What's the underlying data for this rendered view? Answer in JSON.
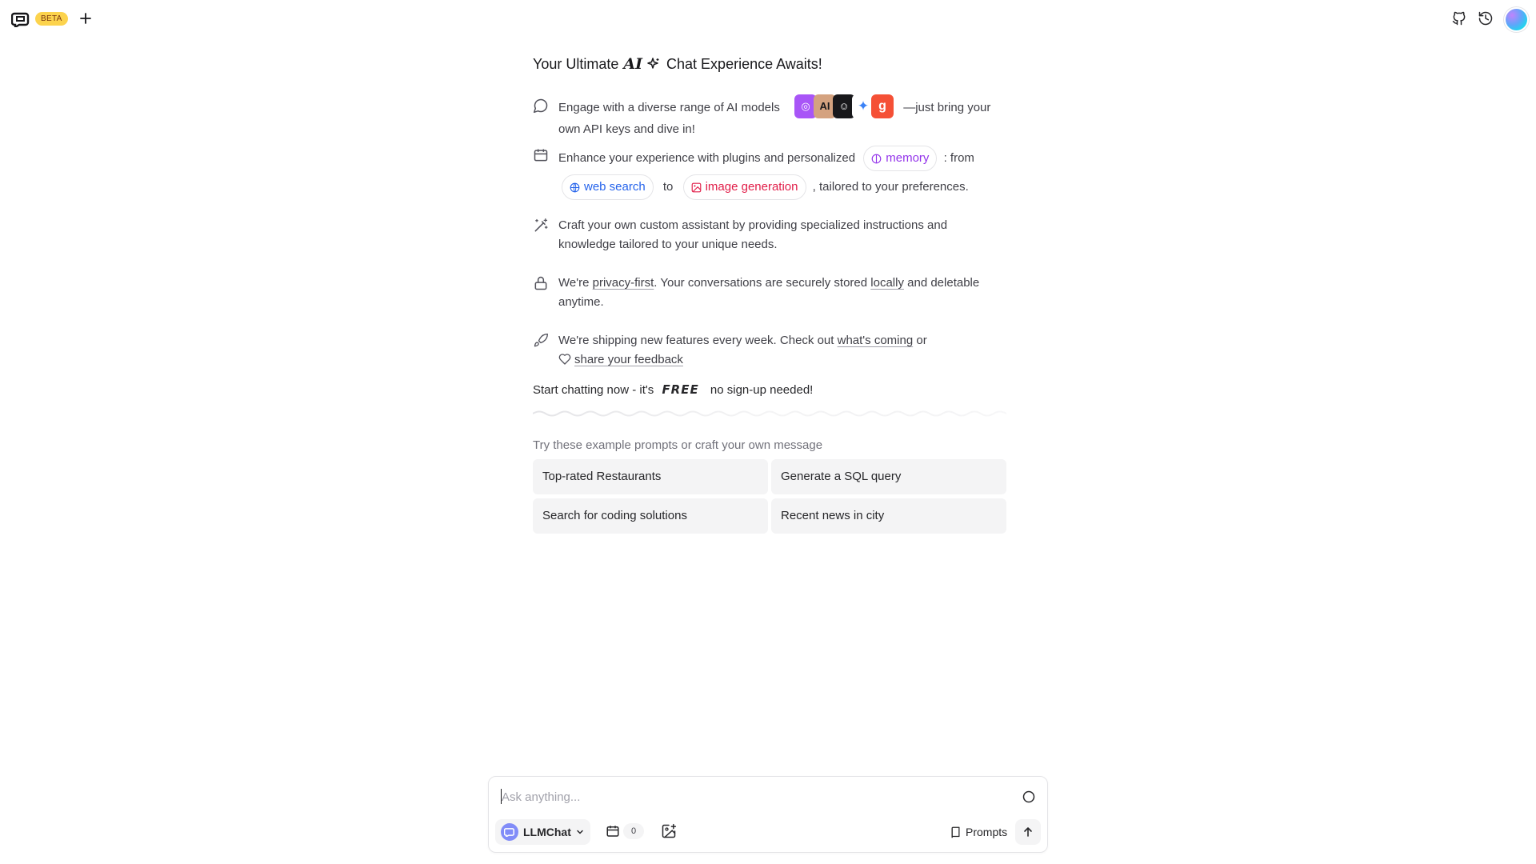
{
  "header": {
    "beta_badge": "BETA",
    "icons": [
      "app-logo-icon",
      "new-chat-plus-icon",
      "github-icon",
      "history-icon",
      "avatar"
    ]
  },
  "welcome": {
    "title_before": "Your Ultimate",
    "title_ai": "AI",
    "title_after": "Chat Experience Awaits!",
    "feature1": {
      "text": "Engage with a diverse range of AI models",
      "models": [
        {
          "name": "openai",
          "glyph": "◎",
          "color": "#a855f7"
        },
        {
          "name": "anthropic",
          "glyph": "AI",
          "color": "#d4a27f"
        },
        {
          "name": "ollama",
          "glyph": "☺",
          "color": "#18181b"
        },
        {
          "name": "gemini",
          "glyph": "✦",
          "color": "#ffffff"
        },
        {
          "name": "groq",
          "glyph": "g",
          "color": "#f55036"
        }
      ],
      "text_after": "—just bring your own API keys and dive in!"
    },
    "feature2": {
      "text_before": "Enhance your experience with plugins and personalized",
      "memory_chip": "memory",
      "text_from": ": from",
      "web_chip": "web search",
      "text_to": "to",
      "image_chip": "image generation",
      "text_after": ", tailored to your preferences."
    },
    "feature3": {
      "text": "Craft your own custom assistant by providing specialized instructions and knowledge tailored to your unique needs."
    },
    "feature4": {
      "text_before": "We're",
      "link1": "privacy-first",
      "text_mid": ". Your conversations are securely stored",
      "link2": "locally",
      "text_after": "and deletable anytime."
    },
    "feature5": {
      "text_before": "We're shipping new features every week. Check out",
      "link1": "what's coming",
      "text_or": "or",
      "link2": "share your feedback"
    },
    "cta_before": "Start chatting now - it's",
    "cta_free": "FREE",
    "cta_after": "no sign-up needed!"
  },
  "examples": {
    "title": "Try these example prompts or craft your own message",
    "items": [
      "Top-rated Restaurants",
      "Generate a SQL query",
      "Search for coding solutions",
      "Recent news in city"
    ]
  },
  "composer": {
    "placeholder": "Ask anything...",
    "model_label": "LLMChat",
    "plugin_count": "0",
    "prompts_label": "Prompts"
  }
}
